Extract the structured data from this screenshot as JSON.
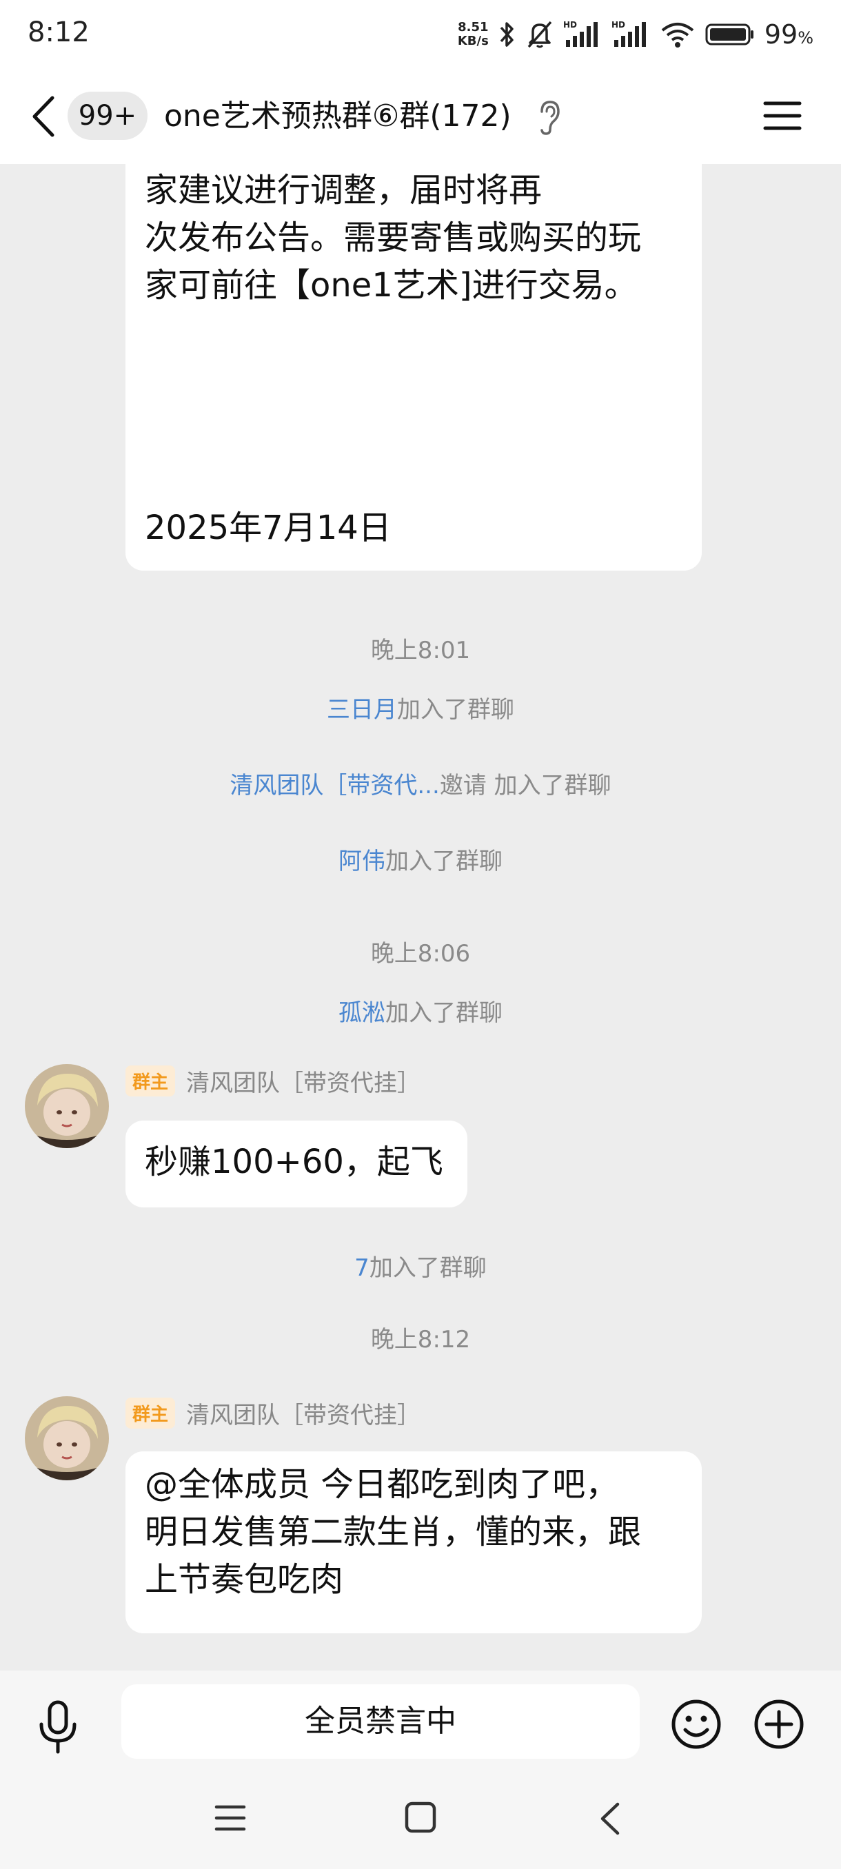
{
  "status_bar": {
    "time": "8:12",
    "net_speed_value": "8.51",
    "net_speed_unit": "KB/s",
    "battery_percent": "99",
    "battery_symbol": "%",
    "icons": [
      "bluetooth-icon",
      "mute-bell-icon",
      "hd-signal-icon",
      "hd-signal-icon",
      "wifi-icon",
      "battery-icon"
    ]
  },
  "header": {
    "back_icon": "chevron-left-icon",
    "unread_badge": "99+",
    "title": "one艺术预热群⑥群(172)",
    "ear_icon": "ear-icon",
    "menu_icon": "hamburger-menu-icon"
  },
  "messages": {
    "announcement": {
      "lines": [
        "家建议进行调整，届时将再",
        "次发布公告。需要寄售或购买的玩",
        "家可前往【one1艺术]进行交易。"
      ],
      "date": "2025年7月14日"
    },
    "time1": "晚上8:01",
    "join1": {
      "user": "三日月",
      "action": "加入了群聊"
    },
    "join2": {
      "user": "清风团队［带资代...",
      "action": "邀请 加入了群聊"
    },
    "join3": {
      "user": "阿伟",
      "action": "加入了群聊"
    },
    "time2": "晚上8:06",
    "join4": {
      "user": "孤淞",
      "action": "加入了群聊"
    },
    "msg1": {
      "badge": "群主",
      "sender": "清风团队［带资代挂］",
      "text": "秒赚100+60，起飞"
    },
    "join5": {
      "user": "7",
      "action": "加入了群聊"
    },
    "time3": "晚上8:12",
    "msg2": {
      "badge": "群主",
      "sender": "清风团队［带资代挂］",
      "lines": [
        "@全体成员 今日都吃到肉了吧，",
        "明日发售第二款生肖，懂的来，跟",
        "上节奏包吃肉"
      ]
    }
  },
  "input_bar": {
    "mic_icon": "microphone-icon",
    "muted_text": "全员禁言中",
    "emoji_icon": "smiley-icon",
    "plus_icon": "plus-circle-icon"
  },
  "nav_bar": {
    "icons": [
      "recent-apps-icon",
      "home-square-icon",
      "back-triangle-icon"
    ]
  },
  "colors": {
    "background": "#ededed",
    "bubble": "#ffffff",
    "username_link": "#4a86d0",
    "system_text": "#8a8a8a",
    "owner_badge_text": "#f29a1e",
    "owner_badge_bg": "#fdecd5"
  }
}
